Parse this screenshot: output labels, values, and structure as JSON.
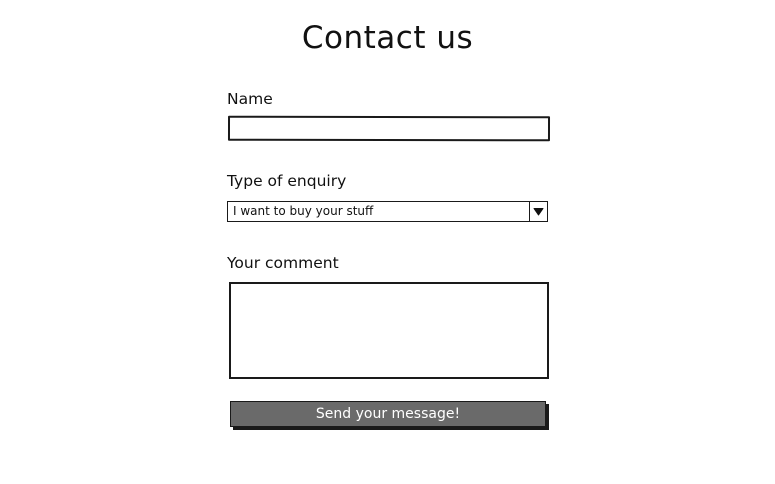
{
  "page": {
    "title": "Contact us"
  },
  "form": {
    "name": {
      "label": "Name",
      "value": ""
    },
    "enquiry": {
      "label": "Type of enquiry",
      "selected": "I want to buy your stuff",
      "arrow_icon": "triangle-down-icon"
    },
    "comment": {
      "label": "Your comment",
      "value": ""
    },
    "submit": {
      "label": "Send your message!"
    }
  },
  "colors": {
    "button_background": "#6a6a6a",
    "button_text": "#ffffff",
    "outline": "#1a1a1a"
  }
}
